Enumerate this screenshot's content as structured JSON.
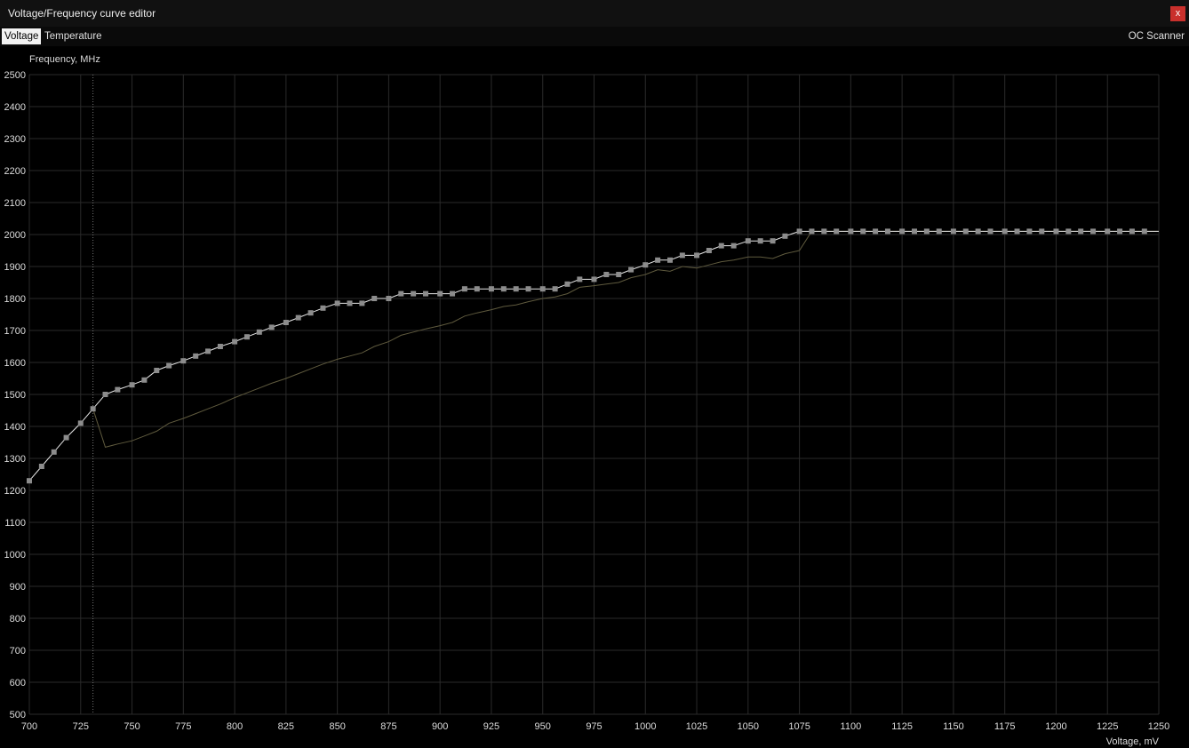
{
  "window": {
    "title": "Voltage/Frequency curve editor",
    "close_label": "x"
  },
  "tabs": [
    {
      "label": "Voltage",
      "active": true
    },
    {
      "label": "Temperature",
      "active": false
    }
  ],
  "oc_scanner_label": "OC Scanner",
  "colors": {
    "background": "#000000",
    "grid": "#2a2a2a",
    "curve": "#e8e8e8",
    "baseline": "#5f5a3e",
    "point": "#8c8c8c",
    "marker": "#777777"
  },
  "chart_data": {
    "type": "line",
    "xlabel": "Voltage, mV",
    "ylabel": "Frequency, MHz",
    "xlim": [
      700,
      1250
    ],
    "ylim": [
      500,
      2500
    ],
    "xticks": [
      700,
      725,
      750,
      775,
      800,
      825,
      850,
      875,
      900,
      925,
      950,
      975,
      1000,
      1025,
      1050,
      1075,
      1100,
      1125,
      1150,
      1175,
      1200,
      1225,
      1250
    ],
    "yticks": [
      500,
      600,
      700,
      800,
      900,
      1000,
      1100,
      1200,
      1300,
      1400,
      1500,
      1600,
      1700,
      1800,
      1900,
      2000,
      2100,
      2200,
      2300,
      2400,
      2500
    ],
    "grid": true,
    "marker_voltage": 731,
    "series": [
      {
        "points": [
          [
            700,
            1230
          ],
          [
            706,
            1275
          ],
          [
            712,
            1320
          ],
          [
            718,
            1365
          ],
          [
            725,
            1410
          ],
          [
            731,
            1455
          ],
          [
            737,
            1500
          ],
          [
            743,
            1515
          ],
          [
            750,
            1530
          ],
          [
            756,
            1545
          ],
          [
            762,
            1575
          ],
          [
            768,
            1590
          ],
          [
            775,
            1605
          ],
          [
            781,
            1620
          ],
          [
            787,
            1635
          ],
          [
            793,
            1650
          ],
          [
            800,
            1665
          ],
          [
            806,
            1680
          ],
          [
            812,
            1695
          ],
          [
            818,
            1710
          ],
          [
            825,
            1725
          ],
          [
            831,
            1740
          ],
          [
            837,
            1755
          ],
          [
            843,
            1770
          ],
          [
            850,
            1785
          ],
          [
            856,
            1785
          ],
          [
            862,
            1785
          ],
          [
            868,
            1800
          ],
          [
            875,
            1800
          ],
          [
            881,
            1815
          ],
          [
            887,
            1815
          ],
          [
            893,
            1815
          ],
          [
            900,
            1815
          ],
          [
            906,
            1815
          ],
          [
            912,
            1830
          ],
          [
            918,
            1830
          ],
          [
            925,
            1830
          ],
          [
            931,
            1830
          ],
          [
            937,
            1830
          ],
          [
            943,
            1830
          ],
          [
            950,
            1830
          ],
          [
            956,
            1830
          ],
          [
            962,
            1845
          ],
          [
            968,
            1860
          ],
          [
            975,
            1860
          ],
          [
            981,
            1875
          ],
          [
            987,
            1875
          ],
          [
            993,
            1890
          ],
          [
            1000,
            1905
          ],
          [
            1006,
            1920
          ],
          [
            1012,
            1920
          ],
          [
            1018,
            1935
          ],
          [
            1025,
            1935
          ],
          [
            1031,
            1950
          ],
          [
            1037,
            1965
          ],
          [
            1043,
            1965
          ],
          [
            1050,
            1980
          ],
          [
            1056,
            1980
          ],
          [
            1062,
            1980
          ],
          [
            1068,
            1995
          ],
          [
            1075,
            2010
          ],
          [
            1081,
            2010
          ],
          [
            1087,
            2010
          ],
          [
            1093,
            2010
          ],
          [
            1100,
            2010
          ],
          [
            1106,
            2010
          ],
          [
            1112,
            2010
          ],
          [
            1118,
            2010
          ],
          [
            1125,
            2010
          ],
          [
            1131,
            2010
          ],
          [
            1137,
            2010
          ],
          [
            1143,
            2010
          ],
          [
            1150,
            2010
          ],
          [
            1156,
            2010
          ],
          [
            1162,
            2010
          ],
          [
            1168,
            2010
          ],
          [
            1175,
            2010
          ],
          [
            1181,
            2010
          ],
          [
            1187,
            2010
          ],
          [
            1193,
            2010
          ],
          [
            1200,
            2010
          ],
          [
            1206,
            2010
          ],
          [
            1212,
            2010
          ],
          [
            1218,
            2010
          ],
          [
            1225,
            2010
          ],
          [
            1231,
            2010
          ],
          [
            1237,
            2010
          ],
          [
            1243,
            2010
          ]
        ],
        "tail_to": 1250
      },
      {
        "points": [
          [
            731,
            1455
          ],
          [
            737,
            1335
          ],
          [
            743,
            1345
          ],
          [
            750,
            1355
          ],
          [
            756,
            1370
          ],
          [
            762,
            1385
          ],
          [
            768,
            1410
          ],
          [
            775,
            1425
          ],
          [
            781,
            1440
          ],
          [
            787,
            1455
          ],
          [
            793,
            1470
          ],
          [
            800,
            1490
          ],
          [
            806,
            1505
          ],
          [
            812,
            1520
          ],
          [
            818,
            1535
          ],
          [
            825,
            1550
          ],
          [
            831,
            1565
          ],
          [
            837,
            1580
          ],
          [
            843,
            1595
          ],
          [
            850,
            1610
          ],
          [
            856,
            1620
          ],
          [
            862,
            1630
          ],
          [
            868,
            1650
          ],
          [
            875,
            1665
          ],
          [
            881,
            1685
          ],
          [
            887,
            1695
          ],
          [
            893,
            1705
          ],
          [
            900,
            1715
          ],
          [
            906,
            1725
          ],
          [
            912,
            1745
          ],
          [
            918,
            1755
          ],
          [
            925,
            1765
          ],
          [
            931,
            1775
          ],
          [
            937,
            1780
          ],
          [
            943,
            1790
          ],
          [
            950,
            1800
          ],
          [
            956,
            1805
          ],
          [
            962,
            1815
          ],
          [
            968,
            1835
          ],
          [
            975,
            1840
          ],
          [
            981,
            1845
          ],
          [
            987,
            1850
          ],
          [
            993,
            1865
          ],
          [
            1000,
            1875
          ],
          [
            1006,
            1890
          ],
          [
            1012,
            1885
          ],
          [
            1018,
            1900
          ],
          [
            1025,
            1895
          ],
          [
            1031,
            1905
          ],
          [
            1037,
            1915
          ],
          [
            1043,
            1920
          ],
          [
            1050,
            1930
          ],
          [
            1056,
            1930
          ],
          [
            1062,
            1925
          ],
          [
            1068,
            1940
          ],
          [
            1075,
            1950
          ],
          [
            1081,
            2010
          ],
          [
            1250,
            2010
          ]
        ]
      }
    ]
  }
}
